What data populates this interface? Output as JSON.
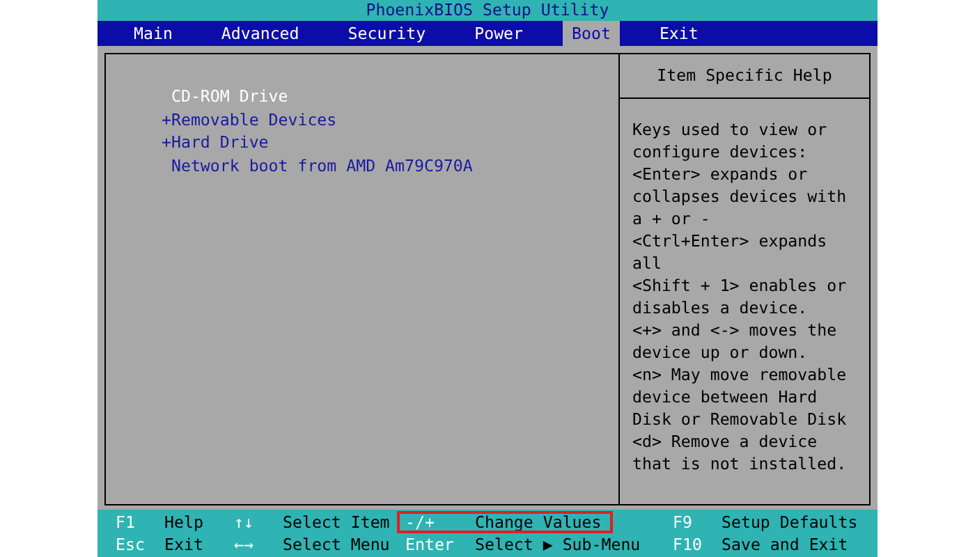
{
  "title": "PhoenixBIOS Setup Utility",
  "tabs": [
    {
      "label": "Main",
      "selected": false
    },
    {
      "label": "Advanced",
      "selected": false
    },
    {
      "label": "Security",
      "selected": false
    },
    {
      "label": "Power",
      "selected": false
    },
    {
      "label": "Boot",
      "selected": true
    },
    {
      "label": "Exit",
      "selected": false
    }
  ],
  "boot_items": [
    {
      "label": "CD-ROM Drive",
      "selected": true
    },
    {
      "label": "+Removable Devices",
      "selected": false
    },
    {
      "label": "+Hard Drive",
      "selected": false
    },
    {
      "label": "Network boot from AMD Am79C970A",
      "selected": false
    }
  ],
  "help": {
    "title": "Item Specific Help",
    "lines": [
      "Keys used to view or",
      "configure devices:",
      "<Enter> expands or",
      "collapses devices with",
      "a + or -",
      "<Ctrl+Enter> expands",
      "all",
      "<Shift + 1> enables or",
      "disables a device.",
      "<+> and <-> moves the",
      "device up or down.",
      "<n> May move removable",
      "device between Hard",
      "Disk or Removable Disk",
      "<d> Remove a device",
      "that is not installed."
    ]
  },
  "footer": [
    [
      {
        "key": "F1",
        "action": "Help",
        "highlighted": false
      },
      {
        "key": "↑↓",
        "action": "Select Item",
        "highlighted": false
      },
      {
        "key": "-/+",
        "action": "Change Values",
        "highlighted": true
      },
      {
        "key": "F9",
        "action": "Setup Defaults",
        "highlighted": false
      }
    ],
    [
      {
        "key": "Esc",
        "action": "Exit",
        "highlighted": false
      },
      {
        "key": "←→",
        "action": "Select Menu",
        "highlighted": false
      },
      {
        "key": "Enter",
        "action": "Select ▶ Sub-Menu",
        "highlighted": false
      },
      {
        "key": "F10",
        "action": "Save and Exit",
        "highlighted": false
      }
    ]
  ]
}
